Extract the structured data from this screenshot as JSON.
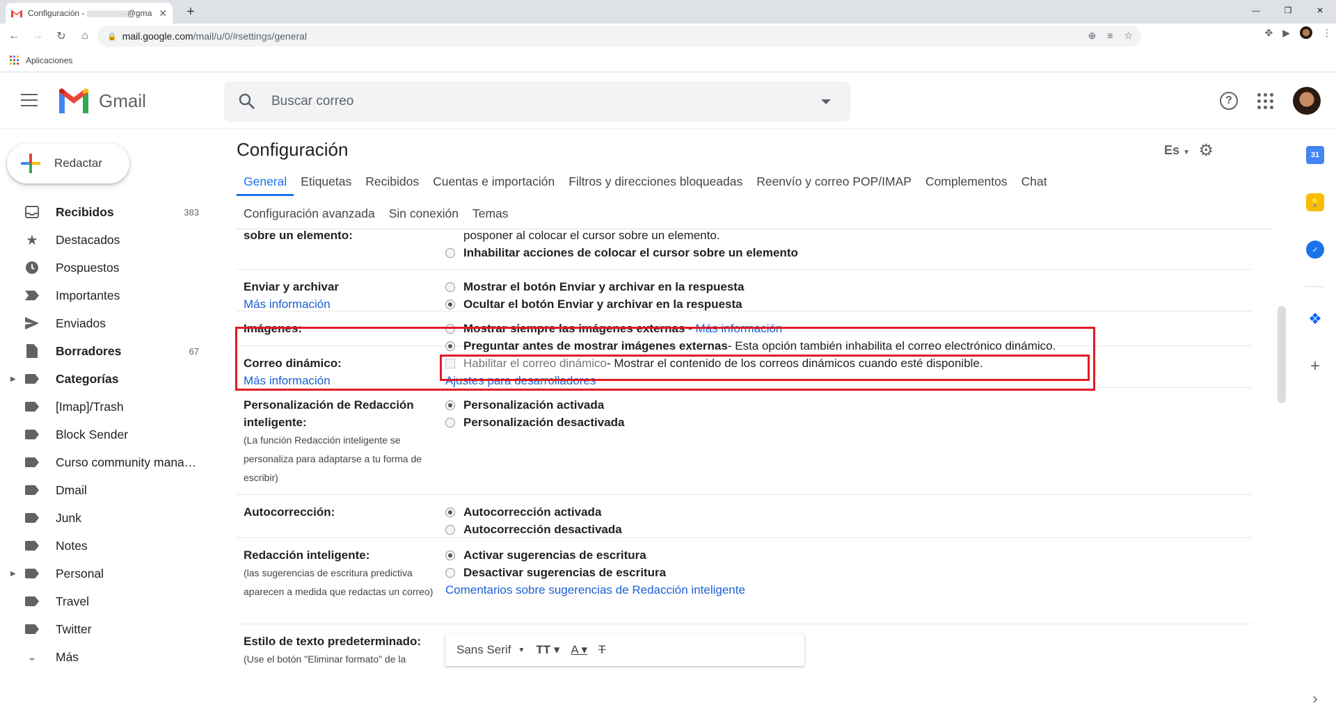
{
  "browser": {
    "tab_title": "Configuración - ",
    "tab_email_suffix": "@gma",
    "url_host": "mail.google.com",
    "url_path": "/mail/u/0/#settings/general",
    "bookmarks_label": "Aplicaciones"
  },
  "header": {
    "wordmark": "Gmail",
    "search_placeholder": "Buscar correo"
  },
  "sidebar": {
    "compose_label": "Redactar",
    "items": [
      {
        "label": "Recibidos",
        "count": "383",
        "bold": true,
        "icon": "inbox-icon"
      },
      {
        "label": "Destacados",
        "count": "",
        "icon": "star-icon"
      },
      {
        "label": "Pospuestos",
        "count": "",
        "icon": "clock-icon"
      },
      {
        "label": "Importantes",
        "count": "",
        "icon": "important-icon"
      },
      {
        "label": "Enviados",
        "count": "",
        "icon": "send-icon"
      },
      {
        "label": "Borradores",
        "count": "67",
        "bold": true,
        "icon": "draft-icon"
      },
      {
        "label": "Categorías",
        "count": "",
        "bold": true,
        "icon": "label-icon"
      },
      {
        "label": "[Imap]/Trash",
        "count": "",
        "icon": "label-icon"
      },
      {
        "label": "Block Sender",
        "count": "",
        "icon": "label-icon"
      },
      {
        "label": "Curso community mana…",
        "count": "",
        "icon": "label-icon"
      },
      {
        "label": "Dmail",
        "count": "",
        "icon": "label-icon"
      },
      {
        "label": "Junk",
        "count": "",
        "icon": "label-icon"
      },
      {
        "label": "Notes",
        "count": "",
        "icon": "label-icon"
      },
      {
        "label": "Personal",
        "count": "",
        "icon": "label-icon"
      },
      {
        "label": "Travel",
        "count": "",
        "icon": "label-icon"
      },
      {
        "label": "Twitter",
        "count": "",
        "icon": "label-icon"
      },
      {
        "label": "Más",
        "count": "",
        "icon": "chevron-down-icon"
      }
    ]
  },
  "settings": {
    "title": "Configuración",
    "lang": "Es",
    "tabs_row1": [
      "General",
      "Etiquetas",
      "Recibidos",
      "Cuentas e importación",
      "Filtros y direcciones bloqueadas",
      "Reenvío y correo POP/IMAP",
      "Complementos",
      "Chat"
    ],
    "tabs_row2": [
      "Configuración avanzada",
      "Sin conexión",
      "Temas"
    ],
    "hover": {
      "label": "sobre un elemento:",
      "text_above": "posponer al colocar el cursor sobre un elemento.",
      "option_disable": "Inhabilitar acciones de colocar el cursor sobre un elemento"
    },
    "send_archive": {
      "label": "Enviar y archivar",
      "link": "Más información",
      "option_show": "Mostrar el botón Enviar y archivar en la respuesta",
      "option_hide": "Ocultar el botón Enviar y archivar en la respuesta"
    },
    "images": {
      "label": "Imágenes:",
      "option_always": "Mostrar siempre las imágenes externas",
      "option_always_link": "Más información",
      "option_ask": "Preguntar antes de mostrar imágenes externas",
      "option_ask_note": " - Esta opción también inhabilita el correo electrónico dinámico."
    },
    "dynamic": {
      "label": "Correo dinámico:",
      "link": "Más información",
      "option": "Habilitar el correo dinámico",
      "option_note": " - Mostrar el contenido de los correos dinámicos cuando esté disponible.",
      "dev_link": "Ajustes para desarrolladores"
    },
    "smart_compose_personal": {
      "label": "Personalización de Redacción inteligente:",
      "note": "(La función Redacción inteligente se personaliza para adaptarse a tu forma de escribir)",
      "option_on": "Personalización activada",
      "option_off": "Personalización desactivada"
    },
    "autocorrect": {
      "label": "Autocorrección:",
      "option_on": "Autocorrección activada",
      "option_off": "Autocorrección desactivada"
    },
    "smart_compose": {
      "label": "Redacción inteligente:",
      "note": "(las sugerencias de escritura predictiva aparecen a medida que redactas un correo)",
      "option_on": "Activar sugerencias de escritura",
      "option_off": "Desactivar sugerencias de escritura",
      "feedback_link": "Comentarios sobre sugerencias de Redacción inteligente"
    },
    "default_text": {
      "label": "Estilo de texto predeterminado:",
      "note": "(Use el botón \"Eliminar formato\" de la",
      "font": "Sans Serif"
    }
  },
  "colors": {
    "accent": "#1a73e8",
    "highlight": "#e01c24",
    "link": "#1a5fd4"
  }
}
